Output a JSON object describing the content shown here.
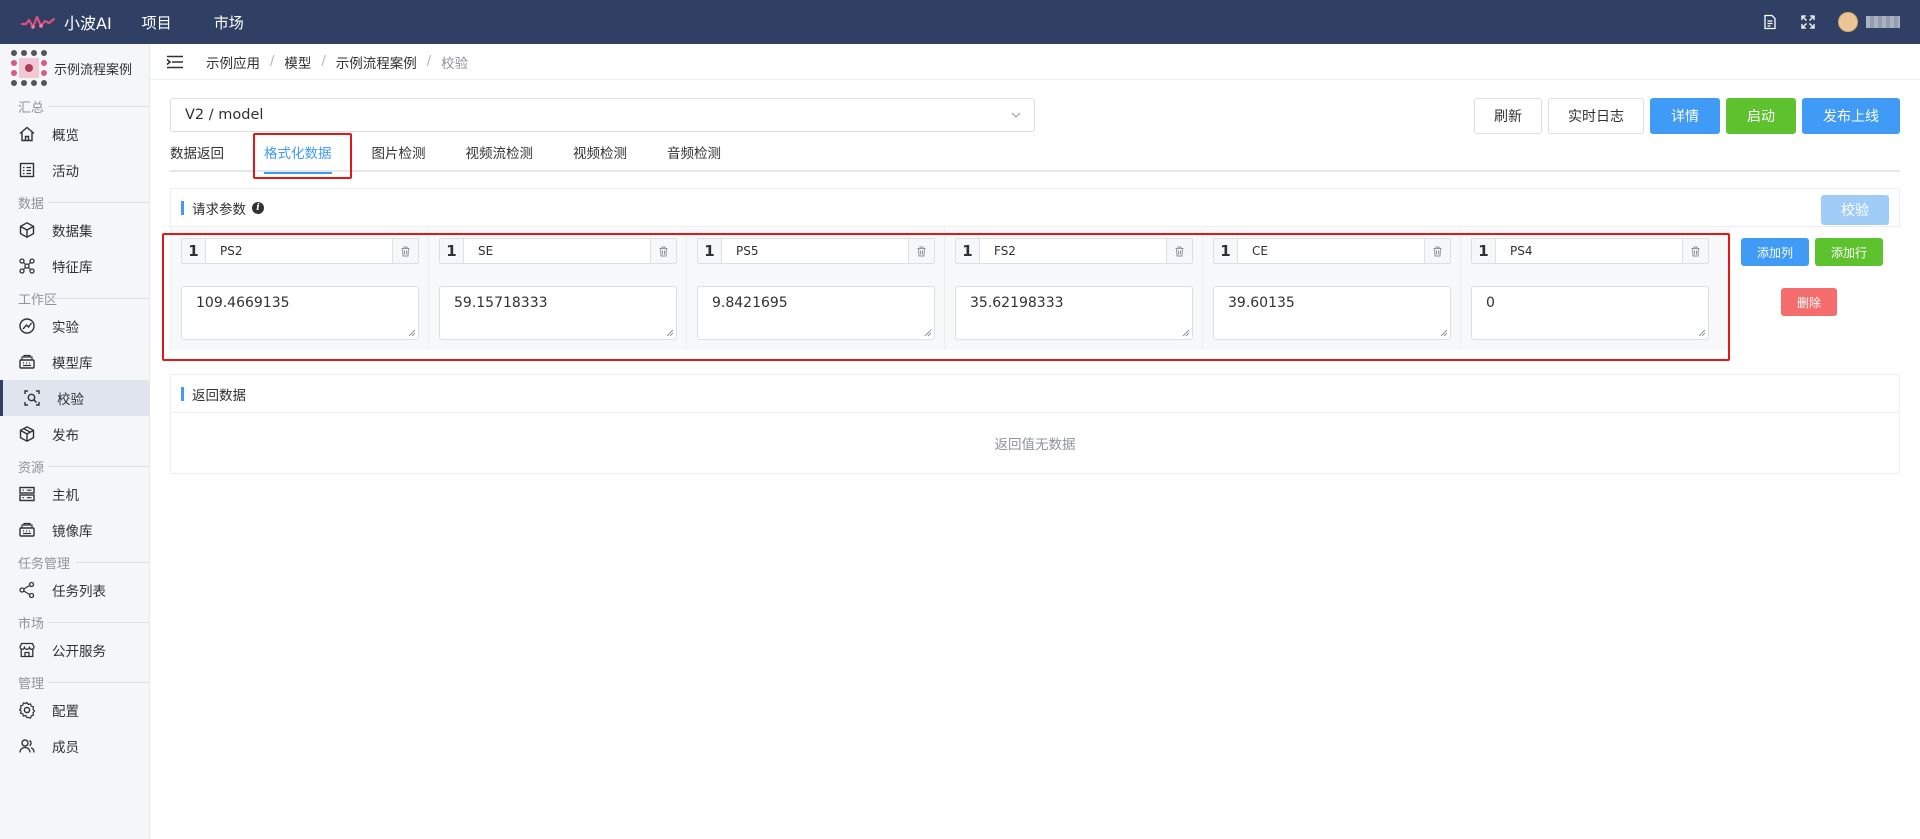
{
  "app": {
    "name": "小波AI"
  },
  "top_menu": [
    "项目",
    "市场"
  ],
  "icons": {
    "doc": "document-icon",
    "fullscreen": "fullscreen-icon",
    "avatar": "avatar-icon"
  },
  "sidebar": {
    "project_name": "示例流程案例",
    "groups": [
      {
        "label": "汇总",
        "items": [
          {
            "label": "概览",
            "icon": "home-icon"
          },
          {
            "label": "活动",
            "icon": "activity-icon"
          }
        ]
      },
      {
        "label": "数据",
        "items": [
          {
            "label": "数据集",
            "icon": "cube-icon"
          },
          {
            "label": "特征库",
            "icon": "feature-icon"
          }
        ]
      },
      {
        "label": "工作区",
        "items": [
          {
            "label": "实验",
            "icon": "experiment-icon"
          },
          {
            "label": "模型库",
            "icon": "model-library-icon"
          },
          {
            "label": "校验",
            "icon": "verify-icon",
            "active": true
          },
          {
            "label": "发布",
            "icon": "package-icon"
          }
        ]
      },
      {
        "label": "资源",
        "items": [
          {
            "label": "主机",
            "icon": "server-icon"
          },
          {
            "label": "镜像库",
            "icon": "image-library-icon"
          }
        ]
      },
      {
        "label": "任务管理",
        "items": [
          {
            "label": "任务列表",
            "icon": "task-icon"
          }
        ]
      },
      {
        "label": "市场",
        "items": [
          {
            "label": "公开服务",
            "icon": "shop-icon"
          }
        ]
      },
      {
        "label": "管理",
        "items": [
          {
            "label": "配置",
            "icon": "gear-icon"
          },
          {
            "label": "成员",
            "icon": "members-icon"
          }
        ]
      }
    ]
  },
  "breadcrumb": [
    "示例应用",
    "模型",
    "示例流程案例",
    "校验"
  ],
  "model_select": {
    "value": "V2 / model"
  },
  "actions": {
    "refresh": "刷新",
    "log": "实时日志",
    "detail": "详情",
    "start": "启动",
    "publish": "发布上线"
  },
  "tabs": [
    {
      "label": "数据返回",
      "active": false
    },
    {
      "label": "格式化数据",
      "active": true
    },
    {
      "label": "图片检测",
      "active": false
    },
    {
      "label": "视频流检测",
      "active": false
    },
    {
      "label": "视频检测",
      "active": false
    },
    {
      "label": "音频检测",
      "active": false
    }
  ],
  "request": {
    "title": "请求参数",
    "verify_label": "校验",
    "columns": [
      {
        "dim": "1",
        "key": "PS2",
        "value": "109.4669135"
      },
      {
        "dim": "1",
        "key": "SE",
        "value": "59.15718333"
      },
      {
        "dim": "1",
        "key": "PS5",
        "value": "9.8421695"
      },
      {
        "dim": "1",
        "key": "FS2",
        "value": "35.62198333"
      },
      {
        "dim": "1",
        "key": "CE",
        "value": "39.60135"
      },
      {
        "dim": "1",
        "key": "PS4",
        "value": "0"
      }
    ],
    "add_column": "添加列",
    "add_row": "添加行",
    "delete_row": "删除"
  },
  "response": {
    "title": "返回数据",
    "empty": "返回值无数据"
  },
  "colors": {
    "nav_bg": "#304065",
    "primary": "#3f9bf5",
    "success": "#5dc22e",
    "danger": "#f56c6c",
    "highlight": "#e21818"
  }
}
